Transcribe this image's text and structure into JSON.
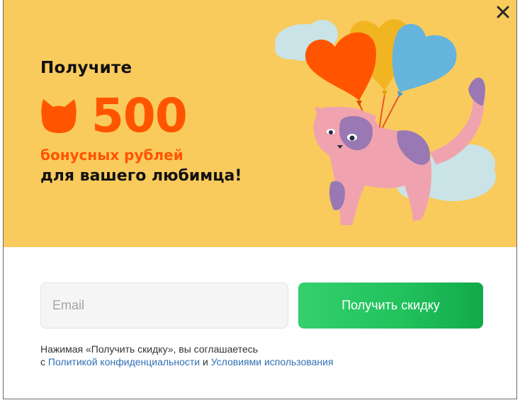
{
  "colors": {
    "hero_background": "#f9cb5c",
    "accent_orange": "#ff5500",
    "button_green": "#22c25d",
    "link_blue": "#2f6fb5"
  },
  "icons": {
    "close": "close-icon",
    "cat_head": "cat-head-icon"
  },
  "hero": {
    "headline": "Получите",
    "amount": "500",
    "bonus_text": "бонусных рублей",
    "pet_text": "для вашего любимца!"
  },
  "form": {
    "email_placeholder": "Email",
    "email_value": "",
    "submit_label": "Получить скидку"
  },
  "consent": {
    "prefix": "Нажимая «Получить скидку», вы соглашаетесь",
    "second_line_start": "с ",
    "privacy_link": "Политикой конфиденциальности",
    "conjunction": " и ",
    "terms_link": "Условиями использования"
  }
}
